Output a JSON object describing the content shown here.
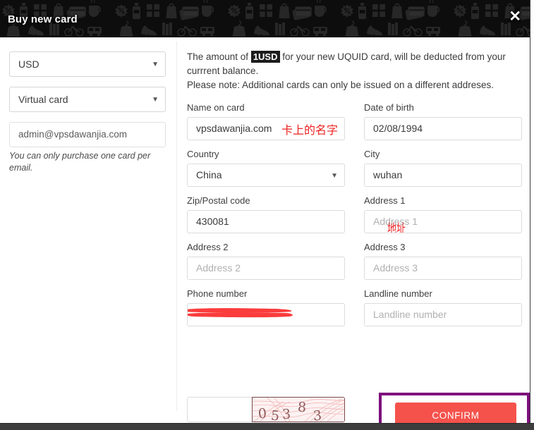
{
  "window": {
    "title": "Buy new card",
    "close_label": "✕"
  },
  "sidebar": {
    "currency_select": {
      "value": "USD",
      "caret": "▼"
    },
    "card_type_select": {
      "value": "Virtual card",
      "caret": "▼"
    },
    "email_field": {
      "value": "admin@vpsdawanjia.com"
    },
    "helper_text": "You can only purchase one card per email."
  },
  "intro": {
    "part1": "The amount of ",
    "amount": "1USD",
    "part2": " for your new UQUID card, will be deducted from your currrent balance.",
    "note": "Please note: Additional cards can only be issued on a different addreses."
  },
  "form": {
    "name_on_card": {
      "label": "Name on card",
      "value": "vpsdawanjia.com",
      "annotation": "卡上的名字"
    },
    "date_of_birth": {
      "label": "Date of birth",
      "value": "02/08/1994"
    },
    "country": {
      "label": "Country",
      "value": "China",
      "caret": "▼"
    },
    "city": {
      "label": "City",
      "value": "wuhan"
    },
    "zip": {
      "label": "Zip/Postal code",
      "value": "430081"
    },
    "address1": {
      "label": "Address 1",
      "placeholder": "Address 1",
      "annotation": "地址"
    },
    "address2": {
      "label": "Address 2",
      "placeholder": "Address 2"
    },
    "address3": {
      "label": "Address 3",
      "placeholder": "Address 3"
    },
    "phone": {
      "label": "Phone number",
      "placeholder": "",
      "redacted": true
    },
    "landline": {
      "label": "Landline number",
      "placeholder": "Landline number"
    }
  },
  "captcha": {
    "input_value": "",
    "code": "05383",
    "digits": [
      "0",
      "5",
      "3",
      "8",
      "3"
    ]
  },
  "confirm": {
    "label": "CONFIRM"
  },
  "colors": {
    "button_red": "#f5524c",
    "annotation_purple": "#7d0f7d",
    "annotation_red": "#ee2222",
    "header_black": "#0d0d0d"
  }
}
